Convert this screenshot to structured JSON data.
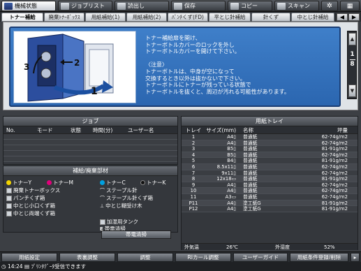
{
  "top_tabs": [
    {
      "label": "機械状態",
      "icon": "machine-status-icon"
    },
    {
      "label": "ジョブリスト",
      "icon": "job-list-icon"
    },
    {
      "label": "読出し",
      "icon": "recall-icon"
    },
    {
      "label": "保存",
      "icon": "save-icon"
    },
    {
      "label": "コピー",
      "icon": "copy-icon"
    },
    {
      "label": "スキャン",
      "icon": "scan-icon"
    }
  ],
  "sub_tabs": [
    "トナー補給",
    "廃棄ﾄﾅｰﾎﾞｯｸｽ",
    "用紙補給(1)",
    "用紙補給(2)",
    "ﾊﾟﾝﾁくず(FD)",
    "平とじ針補給",
    "針くず",
    "中とじ針補給"
  ],
  "guide": {
    "callouts": [
      "1",
      "2",
      "3"
    ],
    "lines": [
      "トナー補給扉を開け、",
      "トナーボトルカバーのロックを外し",
      "トナーボトルカバーを開けて下さい。",
      "",
      "〈注意〉",
      "トナーボトルは、中身が空になって",
      "交換するとき以外は抜かないで下さい。",
      "トナーボトルにトナーが残っている状態で",
      "トナーボトルを抜くと、周辺が汚れる可能性があります。"
    ],
    "page_current": "1",
    "page_total": "8",
    "up_arrow": "▲",
    "down_arrow": "▼"
  },
  "job": {
    "title": "ジョブ",
    "columns": [
      "No.",
      "モード",
      "状態",
      "時間(分)",
      "ユーザー名"
    ]
  },
  "supply": {
    "title": "補給/廃棄部材",
    "items_col1": [
      {
        "label": "トナーY",
        "icon": "toner-y-icon",
        "color": "#f2d400"
      },
      {
        "label": "廃棄トナーボックス",
        "icon": "waste-toner-icon"
      },
      {
        "label": "パンチくず箱",
        "icon": "punch-waste-icon"
      },
      {
        "label": "中とじ小口くず箱",
        "icon": "trim-waste-icon"
      },
      {
        "label": "中とじ両端くず箱",
        "icon": "trim-edge-waste-icon"
      }
    ],
    "toner_m": {
      "label": "トナーM",
      "color": "#e0007a"
    },
    "items_col2": [
      {
        "label": "トナーC",
        "icon": "toner-c-icon",
        "color": "#00a0e0"
      },
      {
        "label": "ステープル針",
        "icon": "staple-icon"
      },
      {
        "label": "ステープル針くず箱",
        "icon": "staple-waste-icon"
      },
      {
        "label": "中とじ糊受け木",
        "icon": "glue-receiver-icon"
      }
    ],
    "toner_k": {
      "label": "トナーK",
      "color": "#111111"
    },
    "items_col3": [
      {
        "label": "加湿用タンク",
        "icon": "humidifier-tank-icon"
      },
      {
        "label": "帯電清掃",
        "icon": "charge-clean-icon"
      }
    ],
    "clean_button": "帯電清掃"
  },
  "tray": {
    "title": "用紙トレイ",
    "columns": [
      "トレイ",
      "サイズ(mm)",
      "名称",
      "坪量"
    ],
    "rows": [
      [
        "1",
        "A4▯",
        "普通紙",
        "62-74g/m2"
      ],
      [
        "2",
        "A4▯",
        "普通紙",
        "62-74g/m2"
      ],
      [
        "3",
        "B5▯",
        "普通紙",
        "81-91g/m2"
      ],
      [
        "4",
        "B5▯",
        "普通紙",
        "62-74g/m2"
      ],
      [
        "5",
        "B4▯",
        "普通紙",
        "81-91g/m2"
      ],
      [
        "6",
        "8.5x11▯",
        "普通紙",
        "62-74g/m2"
      ],
      [
        "7",
        "9x11▯",
        "普通紙",
        "62-74g/m2"
      ],
      [
        "8",
        "12x18▭",
        "普通紙",
        "81-91g/m2"
      ],
      [
        "9",
        "A4▯",
        "普通紙",
        "62-74g/m2"
      ],
      [
        "10",
        "A4▯",
        "普通紙",
        "62-74g/m2"
      ],
      [
        "11",
        "A3▭",
        "普通紙",
        "62-74g/m2"
      ],
      [
        "P11",
        "A4▯",
        "塗工紙G",
        "81-91g/m2"
      ],
      [
        "P12",
        "A4▯",
        "塗工紙G",
        "81-91g/m2"
      ]
    ],
    "outside_temp_label": "外気温",
    "outside_temp": "26℃",
    "humidity_label": "外湿度",
    "humidity": "52%"
  },
  "func_buttons": [
    "用紙設定",
    "表裏調整",
    "調整",
    "RIカール調整",
    "ユーザーガイド",
    "用紙条件登録/削除"
  ],
  "status": {
    "time": "14:24",
    "message": "ﾌﾟﾘﾝﾀﾃﾞｰﾀ受信できます"
  }
}
